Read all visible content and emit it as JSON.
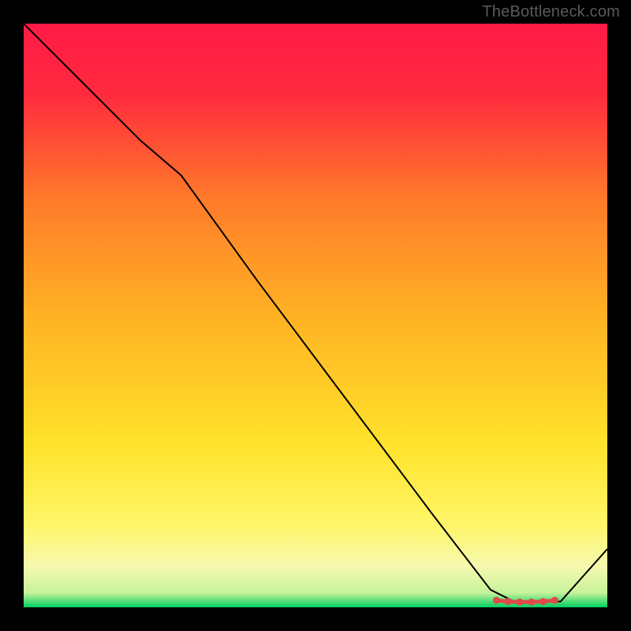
{
  "watermark": "TheBottleneck.com",
  "chart_data": {
    "type": "line",
    "title": "",
    "xlabel": "",
    "ylabel": "",
    "xlim": [
      0,
      100
    ],
    "ylim": [
      0,
      100
    ],
    "grid": false,
    "legend": false,
    "background_gradient": {
      "top_color": "#ff1a46",
      "mid_color": "#ffe22a",
      "bottom_band_color": "#f6f9b0",
      "baseline_color": "#00d060"
    },
    "series": [
      {
        "name": "curve",
        "stroke": "#000000",
        "x": [
          0,
          10,
          20,
          27,
          40,
          55,
          70,
          80,
          84,
          86,
          88,
          90,
          92,
          100
        ],
        "y": [
          100,
          90,
          80,
          74,
          56,
          36,
          16,
          3,
          1,
          1,
          1,
          1,
          1,
          10
        ]
      }
    ],
    "markers": {
      "name": "optimum-band",
      "stroke": "#e04a4a",
      "fill": "#e04a4a",
      "points": [
        {
          "x": 81,
          "y": 1.2
        },
        {
          "x": 83,
          "y": 1.0
        },
        {
          "x": 85,
          "y": 0.9
        },
        {
          "x": 87,
          "y": 0.9
        },
        {
          "x": 89,
          "y": 1.0
        },
        {
          "x": 91,
          "y": 1.2
        }
      ]
    }
  }
}
